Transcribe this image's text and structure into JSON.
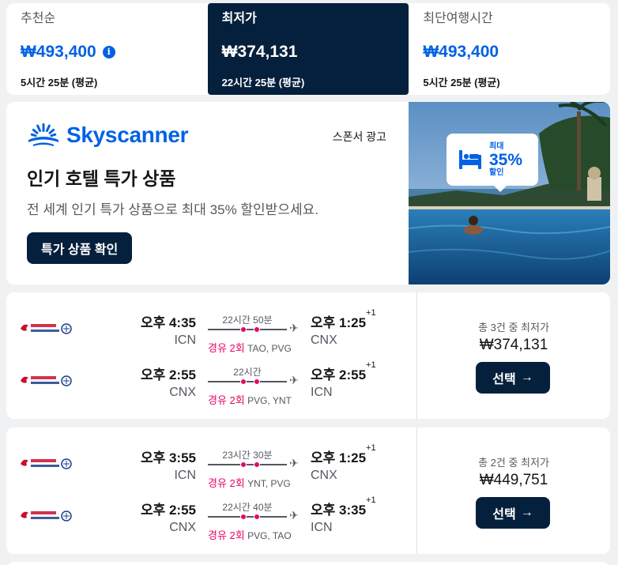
{
  "sort_tabs": [
    {
      "label": "추천순",
      "price": "₩493,400",
      "sub": "5시간 25분 (평균)",
      "info_icon": "info-icon"
    },
    {
      "label": "최저가",
      "price": "₩374,131",
      "sub": "22시간 25분 (평균)"
    },
    {
      "label": "최단여행시간",
      "price": "₩493,400",
      "sub": "5시간 25분 (평균)"
    }
  ],
  "ad": {
    "brand": "Skyscanner",
    "sponsor_label": "스폰서 광고",
    "title": "인기 호텔 특가 상품",
    "description": "전 세계 인기 특가 상품으로 최대 35% 할인받으세요.",
    "button": "특가 상품 확인",
    "badge_top": "최대",
    "badge_main": "35%",
    "badge_bottom": "할인"
  },
  "results": [
    {
      "legs": [
        {
          "dep_time": "오후 4:35",
          "dep_code": "ICN",
          "duration": "22시간 50분",
          "stops": "경유 2회",
          "via": "TAO, PVG",
          "arr_time": "오후 1:25",
          "arr_offset": "+1",
          "arr_code": "CNX"
        },
        {
          "dep_time": "오후 2:55",
          "dep_code": "CNX",
          "duration": "22시간",
          "stops": "경유 2회",
          "via": "PVG, YNT",
          "arr_time": "오후 2:55",
          "arr_offset": "+1",
          "arr_code": "ICN"
        }
      ],
      "price_label": "총 3건 중 최저가",
      "price": "₩374,131",
      "select_label": "선택"
    },
    {
      "legs": [
        {
          "dep_time": "오후 3:55",
          "dep_code": "ICN",
          "duration": "23시간 30분",
          "stops": "경유 2회",
          "via": "YNT, PVG",
          "arr_time": "오후 1:25",
          "arr_offset": "+1",
          "arr_code": "CNX"
        },
        {
          "dep_time": "오후 2:55",
          "dep_code": "CNX",
          "duration": "22시간 40분",
          "stops": "경유 2회",
          "via": "PVG, TAO",
          "arr_time": "오후 3:35",
          "arr_offset": "+1",
          "arr_code": "ICN"
        }
      ],
      "price_label": "총 2건 중 최저가",
      "price": "₩449,751",
      "select_label": "선택"
    }
  ],
  "colors": {
    "accent": "#0062e3",
    "dark": "#05203c",
    "stop": "#e70866"
  }
}
